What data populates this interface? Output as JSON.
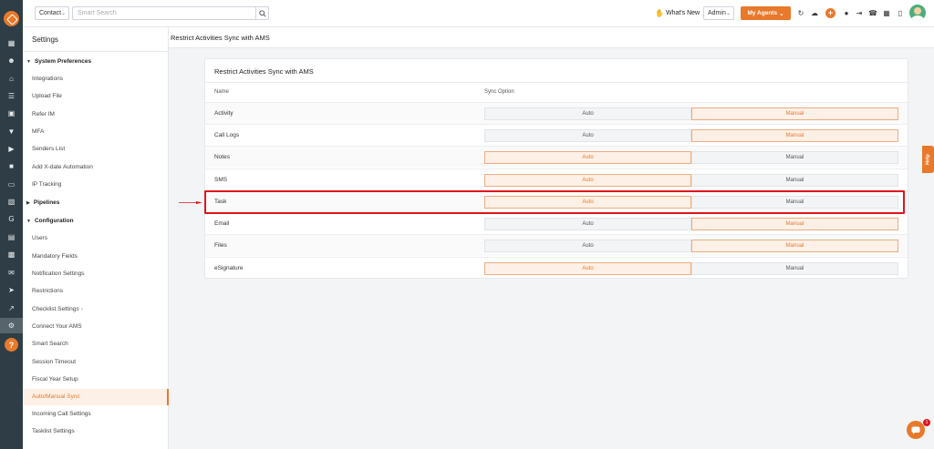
{
  "topbar": {
    "module_select": "Contact",
    "search_placeholder": "Smart Search",
    "whats_new": "What's New",
    "role_select": "Admin",
    "agents_button": "My Agents",
    "icons": [
      "refresh-icon",
      "cloud-icon",
      "plus-icon",
      "notification-icon",
      "logout-icon",
      "phone-icon",
      "calculator-icon",
      "trash-icon",
      "user-avatar"
    ]
  },
  "rail": {
    "icons": [
      "logo-icon",
      "dashboard-icon",
      "contacts-icon",
      "bank-icon",
      "list-icon",
      "calendar-icon",
      "filter-icon",
      "megaphone-icon",
      "document-icon",
      "reports-icon",
      "folder-icon",
      "google-icon",
      "notes-icon",
      "calendar2-icon",
      "mail-icon",
      "plane-icon",
      "analytics-icon",
      "settings-icon",
      "help-icon"
    ]
  },
  "settings": {
    "title": "Settings",
    "system_preferences": {
      "label": "System Preferences",
      "items": [
        "Integrations",
        "Upload File",
        "Refer IM",
        "MFA",
        "Senders List",
        "Add X-date Automation",
        "IP Tracking"
      ]
    },
    "pipelines": {
      "label": "Pipelines"
    },
    "configuration": {
      "label": "Configuration",
      "items": [
        "Users",
        "Mandatory Fields",
        "Notification Settings",
        "Restrictions",
        "Checklist Settings",
        "Connect Your AMS",
        "Smart Search",
        "Session Timeout",
        "Fiscal Year Setup",
        "Auto/Manual Sync",
        "Incoming Call Settings",
        "Tasklist Settings"
      ],
      "active": "Auto/Manual Sync"
    }
  },
  "main": {
    "header": "Restrict Activities Sync with AMS",
    "card_title": "Restrict Activities Sync with AMS",
    "columns": {
      "name": "Name",
      "sync_option": "Sync Option"
    },
    "option_labels": {
      "auto": "Auto",
      "manual": "Manual"
    },
    "rows": [
      {
        "name": "Activity",
        "selected": "Manual"
      },
      {
        "name": "Call Logs",
        "selected": "Manual"
      },
      {
        "name": "Notes",
        "selected": "Auto"
      },
      {
        "name": "SMS",
        "selected": "Auto"
      },
      {
        "name": "Task",
        "selected": "Auto"
      },
      {
        "name": "Email",
        "selected": "Manual"
      },
      {
        "name": "Files",
        "selected": "Manual"
      },
      {
        "name": "eSignature",
        "selected": "Auto"
      }
    ],
    "highlighted_row": "Task"
  },
  "help_tab": "Help",
  "chat_badge": "1",
  "colors": {
    "accent": "#e8792b",
    "highlight": "#e0151d",
    "rail": "#2f3e46"
  }
}
